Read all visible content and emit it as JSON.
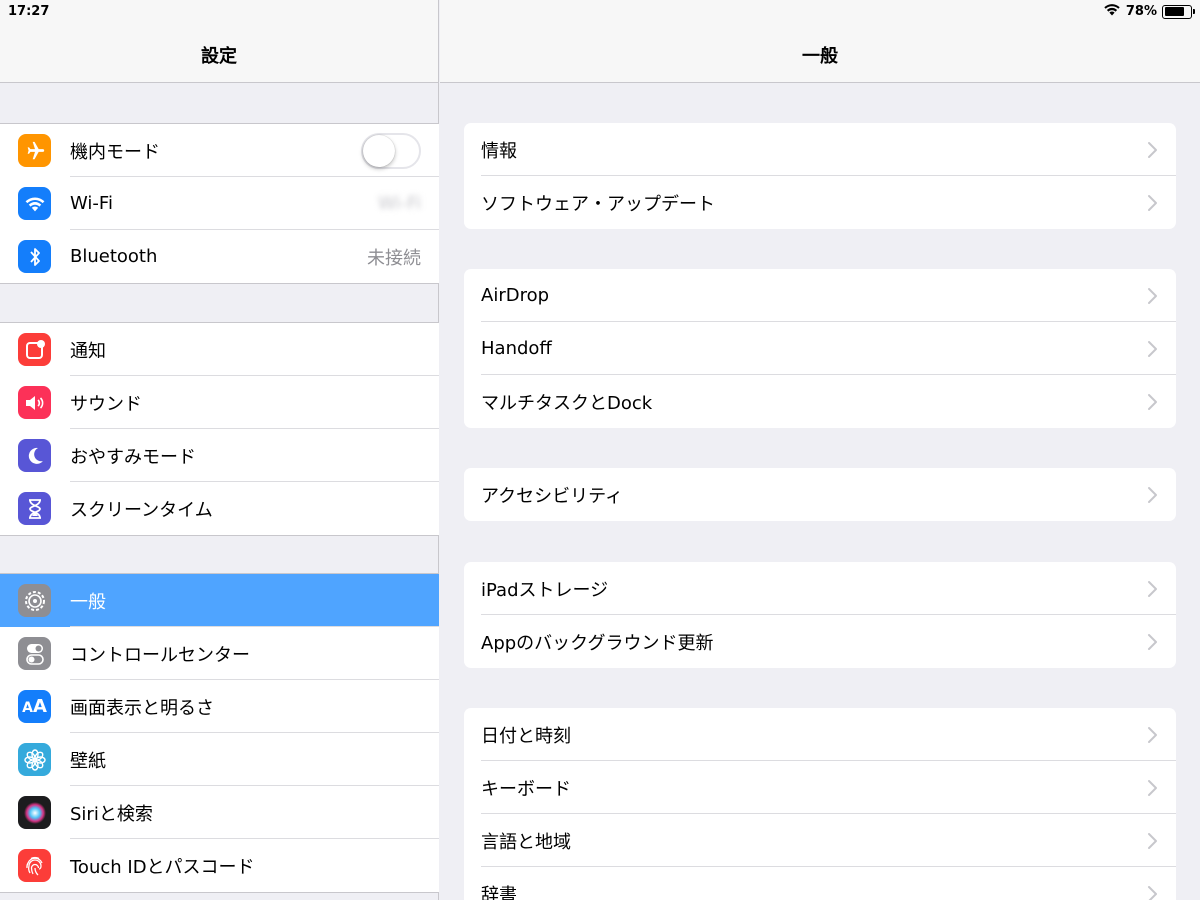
{
  "status": {
    "time": "17:27",
    "battery": "78%",
    "battery_level": 0.78
  },
  "sidebar": {
    "title": "設定",
    "groups": [
      [
        {
          "label": "機内モード",
          "icon": "airplane-icon",
          "color": "#ff9500",
          "toggle": false
        },
        {
          "label": "Wi-Fi",
          "icon": "wifi-icon",
          "color": "#147efb",
          "value": "Wi-Fi"
        },
        {
          "label": "Bluetooth",
          "icon": "bluetooth-icon",
          "color": "#147efb",
          "value": "未接続"
        }
      ],
      [
        {
          "label": "通知",
          "icon": "notifications-icon",
          "color": "#fc3d39"
        },
        {
          "label": "サウンド",
          "icon": "sound-icon",
          "color": "#fc3158"
        },
        {
          "label": "おやすみモード",
          "icon": "moon-icon",
          "color": "#5856d6"
        },
        {
          "label": "スクリーンタイム",
          "icon": "hourglass-icon",
          "color": "#5856d6"
        }
      ],
      [
        {
          "label": "一般",
          "icon": "gear-icon",
          "color": "#8e8e93",
          "selected": true
        },
        {
          "label": "コントロールセンター",
          "icon": "switches-icon",
          "color": "#8e8e93"
        },
        {
          "label": "画面表示と明るさ",
          "icon": "text-size-icon",
          "color": "#147efb"
        },
        {
          "label": "壁紙",
          "icon": "flower-icon",
          "color": "#35aadc"
        },
        {
          "label": "Siriと検索",
          "icon": "siri-icon",
          "color": "#1c1c1e"
        },
        {
          "label": "Touch IDとパスコード",
          "icon": "fingerprint-icon",
          "color": "#fc3d39"
        }
      ]
    ]
  },
  "detail": {
    "title": "一般",
    "groups": [
      [
        "情報",
        "ソフトウェア・アップデート"
      ],
      [
        "AirDrop",
        "Handoff",
        "マルチタスクとDock"
      ],
      [
        "アクセシビリティ"
      ],
      [
        "iPadストレージ",
        "Appのバックグラウンド更新"
      ],
      [
        "日付と時刻",
        "キーボード",
        "言語と地域",
        "辞書"
      ]
    ]
  }
}
